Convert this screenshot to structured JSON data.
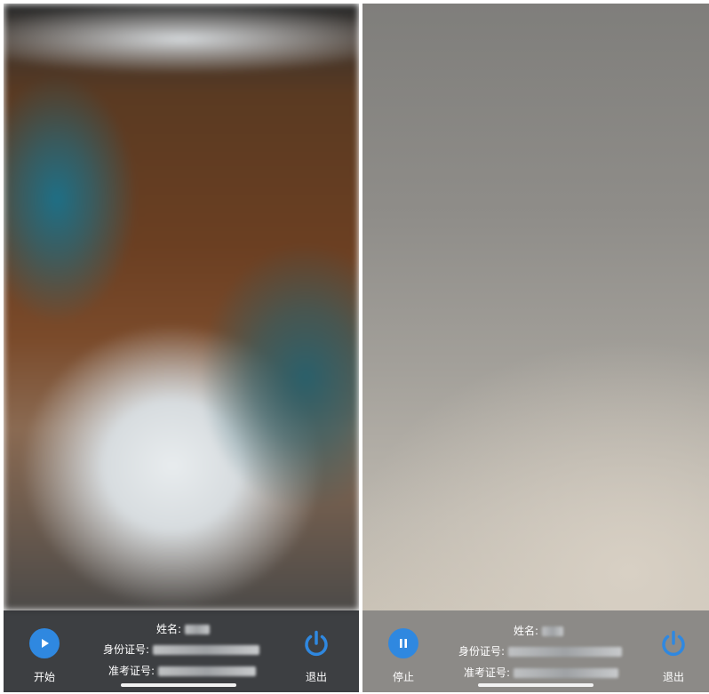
{
  "screens": [
    {
      "primary_button": {
        "label": "开始",
        "icon": "play-icon"
      },
      "exit_button": {
        "label": "退出",
        "icon": "power-icon"
      },
      "info": {
        "name_label": "姓名:",
        "id_label": "身份证号:",
        "ticket_label": "准考证号:"
      }
    },
    {
      "primary_button": {
        "label": "停止",
        "icon": "pause-icon"
      },
      "exit_button": {
        "label": "退出",
        "icon": "power-icon"
      },
      "info": {
        "name_label": "姓名:",
        "id_label": "身份证号:",
        "ticket_label": "准考证号:"
      }
    }
  ],
  "colors": {
    "accent": "#2f88e0",
    "bar_dark": "#2d2f32",
    "text": "#ffffff"
  }
}
